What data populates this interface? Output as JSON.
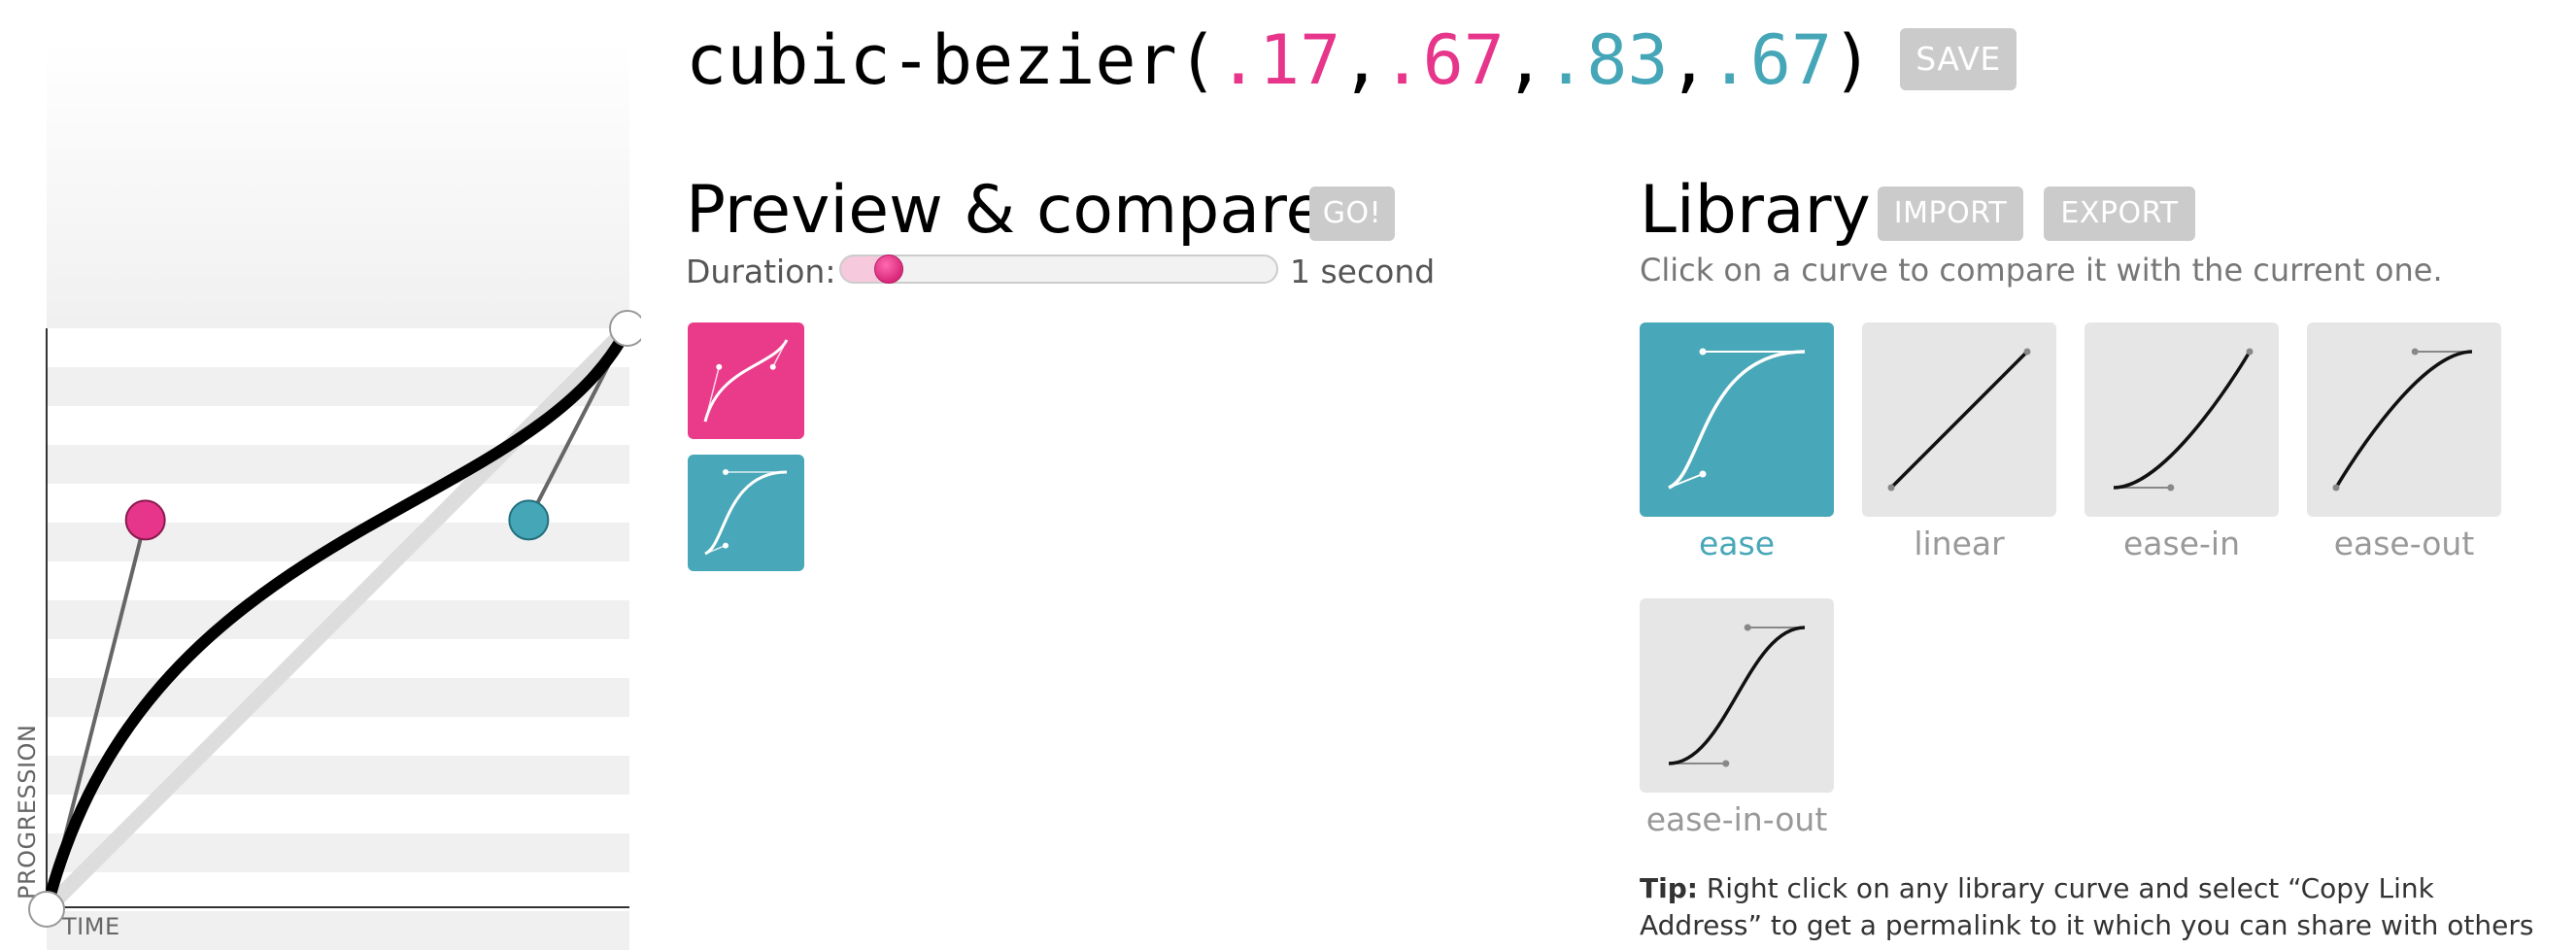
{
  "editor": {
    "time_label": "TIME",
    "progression_label": "PROGRESSION",
    "curve": {
      "p1x": 0.17,
      "p1y": 0.67,
      "p2x": 0.83,
      "p2y": 0.67
    },
    "colors": {
      "p1": "#e6358a",
      "p2": "#45a6b7"
    }
  },
  "header": {
    "function_name": "cubic-bezier(",
    "p1x": ".17",
    "p1y": ".67",
    "p2x": ".83",
    "p2y": ".67",
    "comma": ",",
    "close": ")",
    "save_label": "SAVE"
  },
  "preview": {
    "title": "Preview & compare",
    "go_label": "GO!",
    "duration_label": "Duration:",
    "duration_value": "1 second",
    "duration_fraction": 0.12
  },
  "library": {
    "title": "Library",
    "import_label": "IMPORT",
    "export_label": "EXPORT",
    "hint": "Click on a curve to compare it with the current one.",
    "items": [
      {
        "name": "ease",
        "active": true,
        "curve": [
          0.25,
          0.1,
          0.25,
          1
        ]
      },
      {
        "name": "linear",
        "active": false,
        "curve": [
          0,
          0,
          1,
          1
        ]
      },
      {
        "name": "ease-in",
        "active": false,
        "curve": [
          0.42,
          0,
          1,
          1
        ]
      },
      {
        "name": "ease-out",
        "active": false,
        "curve": [
          0,
          0,
          0.58,
          1
        ]
      },
      {
        "name": "ease-in-out",
        "active": false,
        "curve": [
          0.42,
          0,
          0.58,
          1
        ]
      }
    ]
  },
  "tip": {
    "label": "Tip:",
    "text": " Right click on any library curve and select “Copy Link Address” to get a permalink to it which you can share with others"
  }
}
